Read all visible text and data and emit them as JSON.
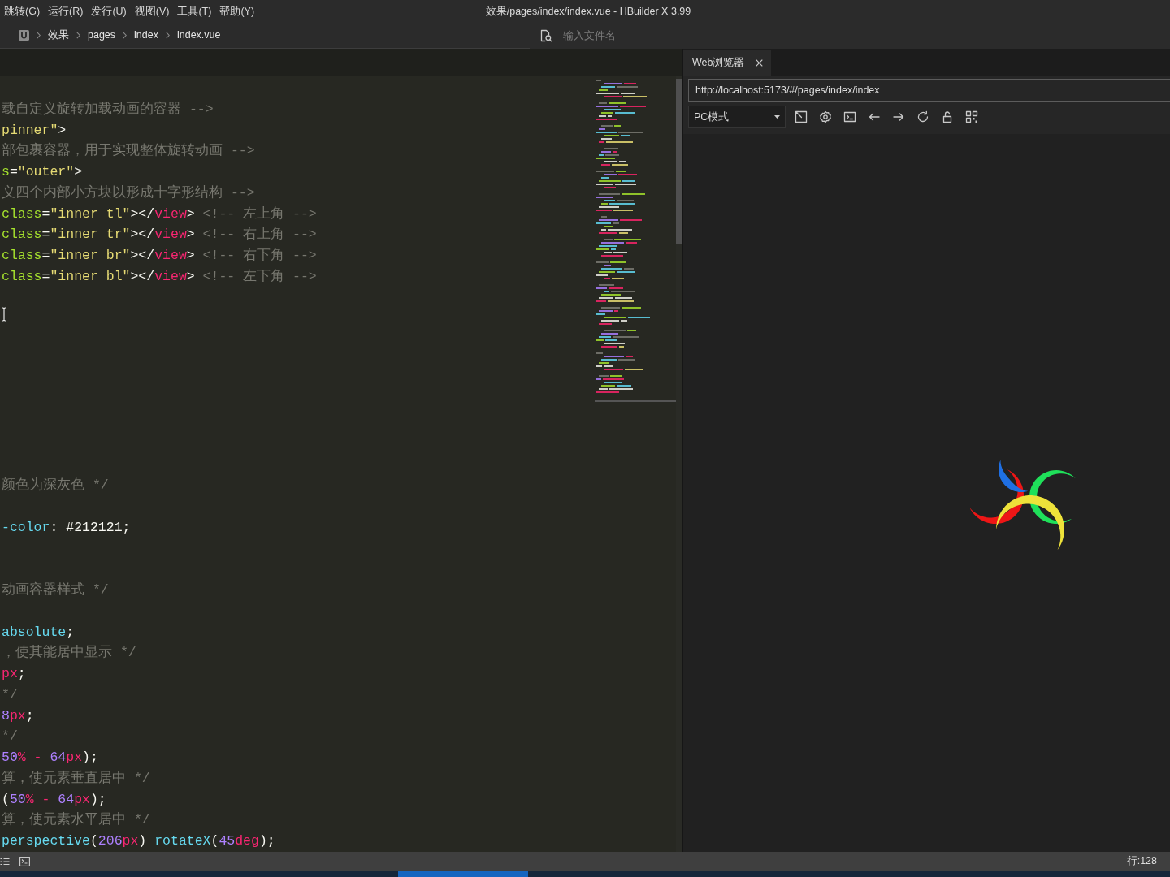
{
  "menu_bar": {
    "items": [
      "跳转(G)",
      "运行(R)",
      "发行(U)",
      "视图(V)",
      "工具(T)",
      "帮助(Y)"
    ],
    "title": "效果/pages/index/index.vue - HBuilder X 3.99"
  },
  "breadcrumb": {
    "items": [
      "效果",
      "pages",
      "index",
      "index.vue"
    ],
    "file_search": {
      "placeholder": "输入文件名"
    }
  },
  "editor": {
    "lines": [
      {
        "kind": "blank"
      },
      {
        "kind": "code",
        "tokens": [
          {
            "kind": "comment",
            "text": "载自定义旋转加载动画的容器 -->"
          }
        ]
      },
      {
        "kind": "code",
        "tokens": [
          {
            "kind": "string",
            "text": "pinner\""
          },
          {
            "kind": "punct",
            "text": ">"
          }
        ]
      },
      {
        "kind": "code",
        "tokens": [
          {
            "kind": "comment",
            "text": "部包裹容器，用于实现整体旋转动画 -->"
          }
        ]
      },
      {
        "kind": "code",
        "tokens": [
          {
            "kind": "attr",
            "text": "s"
          },
          {
            "kind": "punct",
            "text": "="
          },
          {
            "kind": "string",
            "text": "\"outer\""
          },
          {
            "kind": "punct",
            "text": ">"
          }
        ]
      },
      {
        "kind": "code",
        "tokens": [
          {
            "kind": "comment",
            "text": "义四个内部小方块以形成十字形结构 -->"
          }
        ]
      },
      {
        "kind": "code",
        "tokens": [
          {
            "kind": "attr",
            "text": "class"
          },
          {
            "kind": "punct",
            "text": "="
          },
          {
            "kind": "string",
            "text": "\"inner tl\""
          },
          {
            "kind": "punct",
            "text": "></"
          },
          {
            "kind": "tag",
            "text": "view"
          },
          {
            "kind": "punct",
            "text": "> "
          },
          {
            "kind": "comment",
            "text": "<!-- 左上角 -->"
          }
        ]
      },
      {
        "kind": "code",
        "tokens": [
          {
            "kind": "attr",
            "text": "class"
          },
          {
            "kind": "punct",
            "text": "="
          },
          {
            "kind": "string",
            "text": "\"inner tr\""
          },
          {
            "kind": "punct",
            "text": "></"
          },
          {
            "kind": "tag",
            "text": "view"
          },
          {
            "kind": "punct",
            "text": "> "
          },
          {
            "kind": "comment",
            "text": "<!-- 右上角 -->"
          }
        ]
      },
      {
        "kind": "code",
        "tokens": [
          {
            "kind": "attr",
            "text": "class"
          },
          {
            "kind": "punct",
            "text": "="
          },
          {
            "kind": "string",
            "text": "\"inner br\""
          },
          {
            "kind": "punct",
            "text": "></"
          },
          {
            "kind": "tag",
            "text": "view"
          },
          {
            "kind": "punct",
            "text": "> "
          },
          {
            "kind": "comment",
            "text": "<!-- 右下角 -->"
          }
        ]
      },
      {
        "kind": "code",
        "tokens": [
          {
            "kind": "attr",
            "text": "class"
          },
          {
            "kind": "punct",
            "text": "="
          },
          {
            "kind": "string",
            "text": "\"inner bl\""
          },
          {
            "kind": "punct",
            "text": "></"
          },
          {
            "kind": "tag",
            "text": "view"
          },
          {
            "kind": "punct",
            "text": "> "
          },
          {
            "kind": "comment",
            "text": "<!-- 左下角 -->"
          }
        ]
      },
      {
        "kind": "blank"
      },
      {
        "kind": "blank"
      },
      {
        "kind": "blank"
      },
      {
        "kind": "blank"
      },
      {
        "kind": "blank"
      },
      {
        "kind": "blank"
      },
      {
        "kind": "blank"
      },
      {
        "kind": "blank"
      },
      {
        "kind": "blank"
      },
      {
        "kind": "code",
        "tokens": [
          {
            "kind": "comment",
            "text": "颜色为深灰色 */"
          }
        ]
      },
      {
        "kind": "blank"
      },
      {
        "kind": "code",
        "tokens": [
          {
            "kind": "property",
            "text": "-color"
          },
          {
            "kind": "punct",
            "text": ": #212121;"
          }
        ]
      },
      {
        "kind": "blank"
      },
      {
        "kind": "blank"
      },
      {
        "kind": "code",
        "tokens": [
          {
            "kind": "comment",
            "text": "动画容器样式 */"
          }
        ]
      },
      {
        "kind": "blank"
      },
      {
        "kind": "code",
        "tokens": [
          {
            "kind": "property",
            "text": "absolute"
          },
          {
            "kind": "punct",
            "text": ";"
          }
        ]
      },
      {
        "kind": "code",
        "tokens": [
          {
            "kind": "comment",
            "text": "，使其能居中显示 */"
          }
        ]
      },
      {
        "kind": "code",
        "tokens": [
          {
            "kind": "unit",
            "text": "px"
          },
          {
            "kind": "punct",
            "text": ";"
          }
        ]
      },
      {
        "kind": "code",
        "tokens": [
          {
            "kind": "comment",
            "text": "*/"
          }
        ]
      },
      {
        "kind": "code",
        "tokens": [
          {
            "kind": "number",
            "text": "8"
          },
          {
            "kind": "unit",
            "text": "px"
          },
          {
            "kind": "punct",
            "text": ";"
          }
        ]
      },
      {
        "kind": "code",
        "tokens": [
          {
            "kind": "comment",
            "text": "*/"
          }
        ]
      },
      {
        "kind": "code",
        "tokens": [
          {
            "kind": "number",
            "text": "50"
          },
          {
            "kind": "unit",
            "text": "% - "
          },
          {
            "kind": "number",
            "text": "64"
          },
          {
            "kind": "unit",
            "text": "px"
          },
          {
            "kind": "punct",
            "text": ");"
          }
        ]
      },
      {
        "kind": "code",
        "tokens": [
          {
            "kind": "comment",
            "text": "算，使元素垂直居中 */"
          }
        ]
      },
      {
        "kind": "code",
        "tokens": [
          {
            "kind": "punct",
            "text": "("
          },
          {
            "kind": "number",
            "text": "50"
          },
          {
            "kind": "unit",
            "text": "% - "
          },
          {
            "kind": "number",
            "text": "64"
          },
          {
            "kind": "unit",
            "text": "px"
          },
          {
            "kind": "punct",
            "text": ");"
          }
        ]
      },
      {
        "kind": "code",
        "tokens": [
          {
            "kind": "comment",
            "text": "算，使元素水平居中 */"
          }
        ]
      },
      {
        "kind": "code",
        "tokens": [
          {
            "kind": "property",
            "text": "perspective"
          },
          {
            "kind": "punct",
            "text": "("
          },
          {
            "kind": "number",
            "text": "206"
          },
          {
            "kind": "unit",
            "text": "px"
          },
          {
            "kind": "punct",
            "text": ") "
          },
          {
            "kind": "property",
            "text": "rotateX"
          },
          {
            "kind": "punct",
            "text": "("
          },
          {
            "kind": "number",
            "text": "45"
          },
          {
            "kind": "unit",
            "text": "deg"
          },
          {
            "kind": "punct",
            "text": ");"
          }
        ]
      }
    ]
  },
  "browser": {
    "tab": {
      "label": "Web浏览器",
      "selected": true
    },
    "url": "http://localhost:5173/#/pages/index/index",
    "mode": "PC模式",
    "preview": {
      "arcs": [
        {
          "color": "#ee1616"
        },
        {
          "color": "#1f6fe3"
        },
        {
          "color": "#1fe05a"
        },
        {
          "color": "#eee23a"
        }
      ]
    }
  },
  "status_bar": {
    "position": "行:128"
  }
}
